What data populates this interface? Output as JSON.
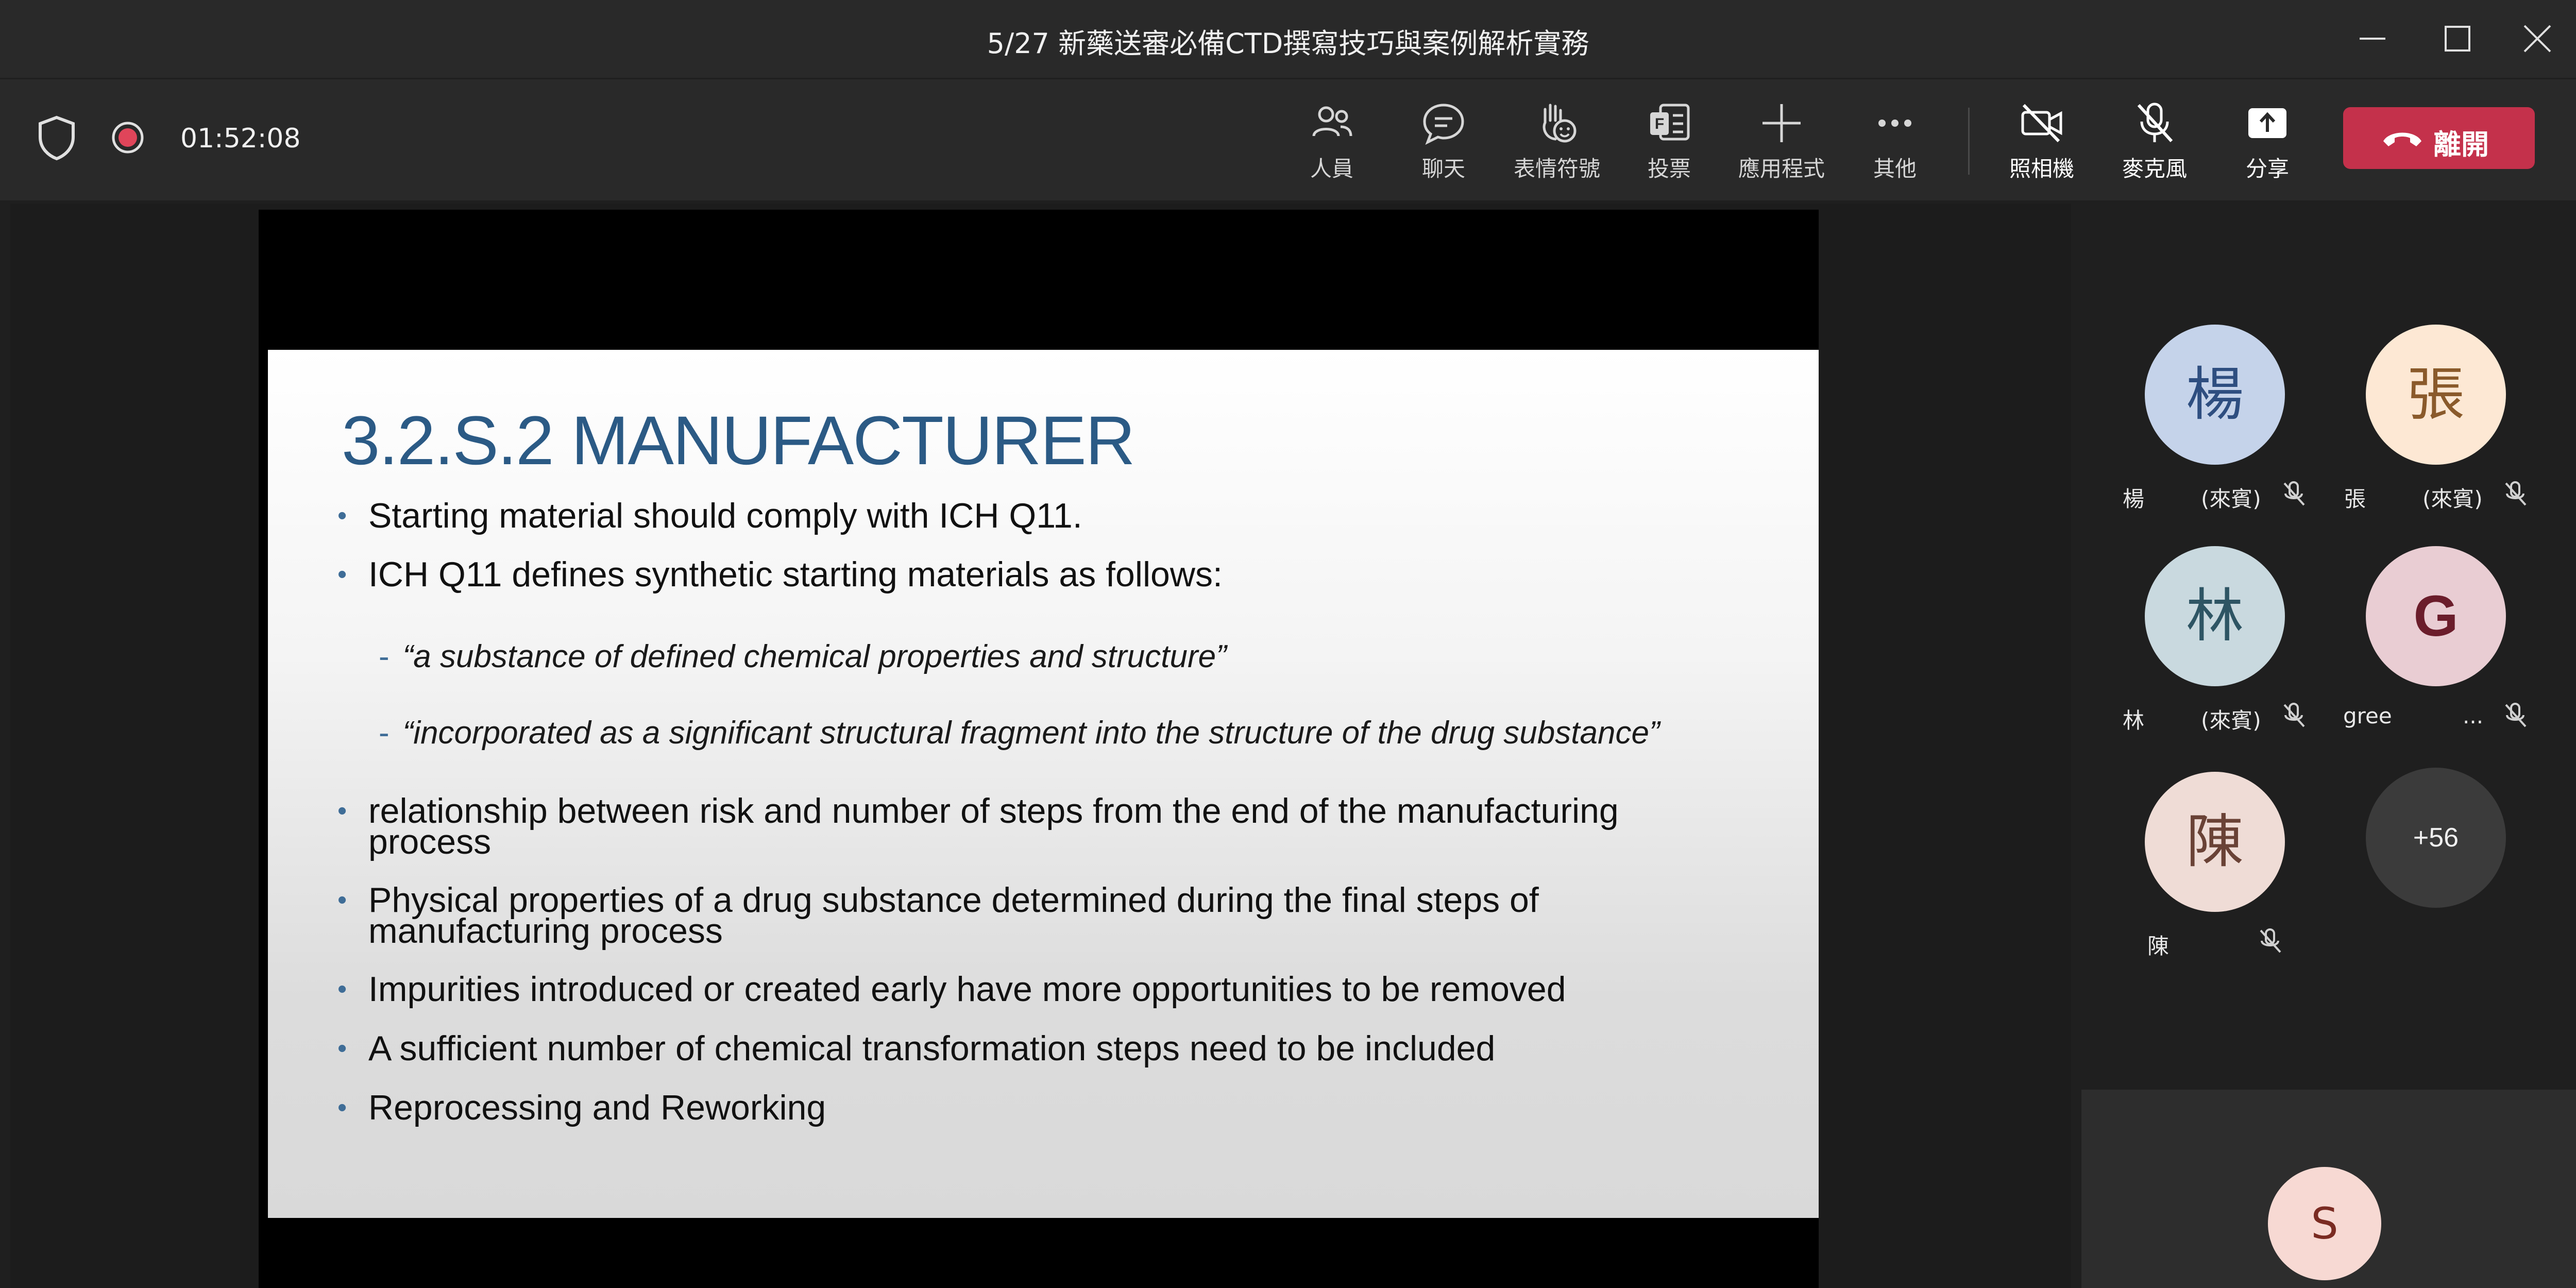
{
  "window": {
    "title": "5/27 新藥送審必備CTD撰寫技巧與案例解析實務"
  },
  "meeting": {
    "elapsed_time": "01:52:08",
    "recording": true
  },
  "toolbar": {
    "items": [
      {
        "label": "人員",
        "icon": "people-icon"
      },
      {
        "label": "聊天",
        "icon": "chat-icon"
      },
      {
        "label": "表情符號",
        "icon": "reactions-icon"
      },
      {
        "label": "投票",
        "icon": "polls-icon"
      },
      {
        "label": "應用程式",
        "icon": "add-icon"
      },
      {
        "label": "其他",
        "icon": "more-icon"
      },
      {
        "label": "照相機",
        "icon": "camera-off-icon"
      },
      {
        "label": "麥克風",
        "icon": "mic-off-icon"
      },
      {
        "label": "分享",
        "icon": "share-icon"
      }
    ],
    "leave_label": "離開"
  },
  "slide": {
    "title": "3.2.S.2 MANUFACTURER",
    "bullets": [
      "Starting material should comply with ICH Q11.",
      "ICH Q11 defines synthetic starting materials as follows:",
      "relationship between risk and number of steps from the end of the manufacturing",
      "process",
      "Physical properties of a drug substance determined during the final steps of",
      "manufacturing process",
      "Impurities introduced or created early have more opportunities to be removed",
      "A sufficient number of chemical transformation steps need to be included",
      "Reprocessing and Reworking"
    ],
    "sub_bullets": [
      "“a substance of defined chemical properties and structure”",
      "“incorporated  as a significant structural fragment into the structure of the drug substance”"
    ],
    "dash": "-",
    "dot": "•"
  },
  "participants": [
    {
      "initial": "楊",
      "name": "楊",
      "tag": "(來賓)",
      "bg": "#c5d3ea",
      "fg": "#2e4e80"
    },
    {
      "initial": "張",
      "name": "張",
      "tag": "(來賓)",
      "bg": "#fde8d4",
      "fg": "#8a5a2b"
    },
    {
      "initial": "林",
      "name": "林",
      "tag": "(來賓)",
      "bg": "#c9d9df",
      "fg": "#2e5564"
    },
    {
      "initial": "G",
      "name": "gree",
      "tag": "...",
      "bg": "#e9cdd3",
      "fg": "#6b1d2b"
    },
    {
      "initial": "陳",
      "name": "陳",
      "tag": "",
      "bg": "#efdcd6",
      "fg": "#6a4236"
    }
  ],
  "overflow_count": "+56",
  "self": {
    "initial": "S"
  },
  "colors": {
    "leave": "#c4314b",
    "title_bar": "#292929",
    "slide_title": "#2b5a85"
  }
}
